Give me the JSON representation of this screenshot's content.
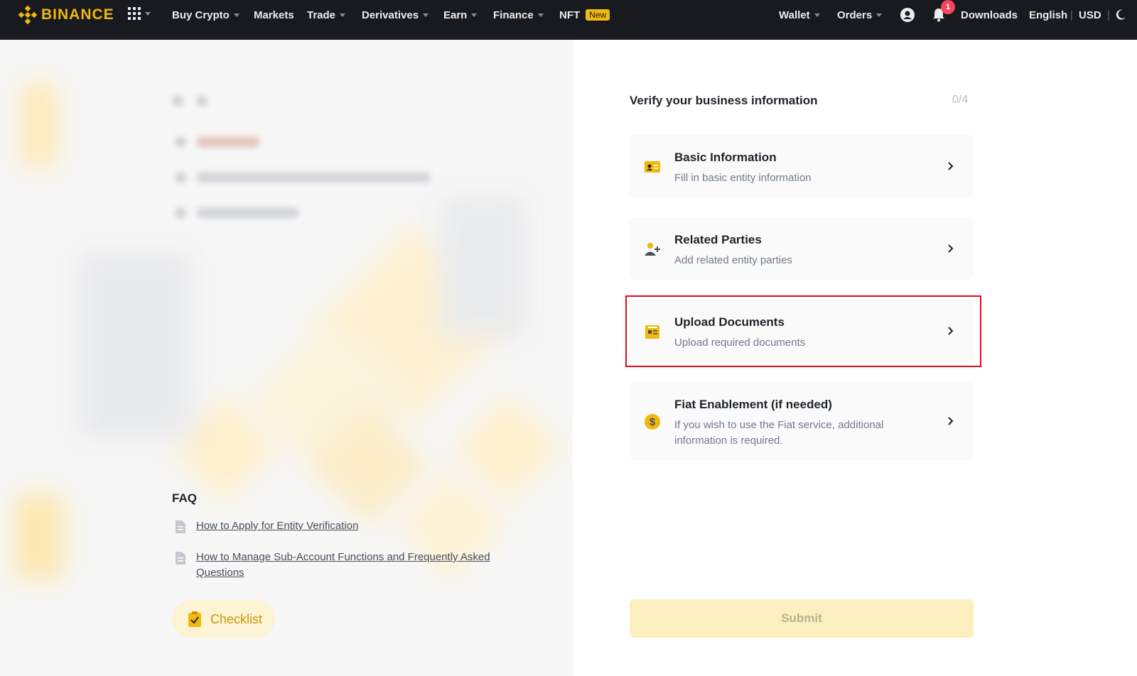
{
  "brand": {
    "name": "BINANCE",
    "accent": "#f0b90b"
  },
  "nav": {
    "items": [
      {
        "label": "Buy Crypto",
        "dropdown": true
      },
      {
        "label": "Markets",
        "dropdown": false
      },
      {
        "label": "Trade",
        "dropdown": true
      },
      {
        "label": "Derivatives",
        "dropdown": true
      },
      {
        "label": "Earn",
        "dropdown": true
      },
      {
        "label": "Finance",
        "dropdown": true
      },
      {
        "label": "NFT",
        "badge": "New"
      }
    ],
    "right": {
      "wallet": "Wallet",
      "orders": "Orders",
      "notification_count": "1",
      "downloads": "Downloads",
      "language": "English",
      "separator": "|",
      "currency": "USD"
    }
  },
  "faq": {
    "title": "FAQ",
    "links": [
      "How to Apply for Entity Verification",
      "How to Manage Sub-Account Functions and Frequently Asked Questions"
    ]
  },
  "checklist_label": "Checklist",
  "verify": {
    "title": "Verify your business information",
    "progress": "0/4",
    "cards": [
      {
        "title": "Basic Information",
        "subtitle": "Fill in basic entity information",
        "icon": "id-card-icon"
      },
      {
        "title": "Related Parties",
        "subtitle": "Add related entity parties",
        "icon": "add-person-icon"
      },
      {
        "title": "Upload Documents",
        "subtitle": "Upload required documents",
        "icon": "document-icon",
        "highlighted": true
      },
      {
        "title": "Fiat Enablement (if needed)",
        "subtitle": "If you wish to use the Fiat service, additional information is required.",
        "icon": "dollar-coin-icon"
      }
    ],
    "submit_label": "Submit"
  },
  "colors": {
    "nav_bg": "#181a20",
    "highlight": "#e5091b",
    "submit_bg": "#fcefbf"
  }
}
